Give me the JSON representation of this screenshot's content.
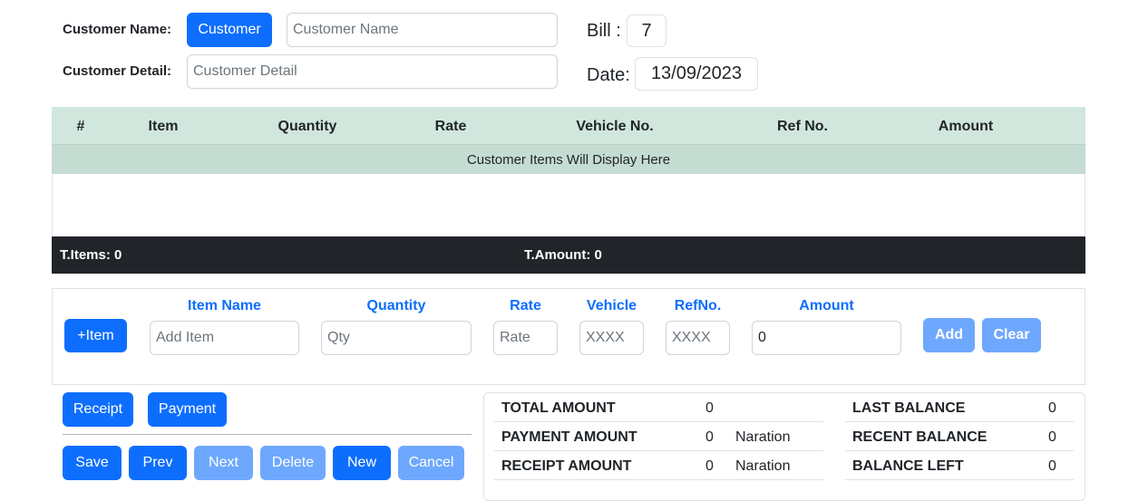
{
  "customer": {
    "name_label": "Customer Name:",
    "customer_button": "Customer",
    "name_placeholder": "Customer Name",
    "detail_label": "Customer Detail:",
    "detail_placeholder": "Customer Detail"
  },
  "bill": {
    "label": "Bill :",
    "number": "7"
  },
  "date": {
    "label": "Date:",
    "value": "13/09/2023"
  },
  "table": {
    "columns": [
      "#",
      "Item",
      "Quantity",
      "Rate",
      "Vehicle No.",
      "Ref No.",
      "Amount"
    ],
    "empty_message": "Customer Items Will Display Here",
    "total_items": "T.Items: 0",
    "total_amount": "T.Amount: 0"
  },
  "item_form": {
    "add_item_button": "+Item",
    "headers": {
      "item_name": "Item Name",
      "quantity": "Quantity",
      "rate": "Rate",
      "vehicle": "Vehicle",
      "refno": "RefNo.",
      "amount": "Amount"
    },
    "placeholders": {
      "item": "Add Item",
      "qty": "Qty",
      "rate": "Rate",
      "vehicle": "XXXX",
      "refno": "XXXX"
    },
    "amount_value": "0",
    "add_button": "Add",
    "clear_button": "Clear"
  },
  "actions": {
    "receipt": "Receipt",
    "payment": "Payment",
    "save": "Save",
    "prev": "Prev",
    "next": "Next",
    "delete": "Delete",
    "new": "New",
    "cancel": "Cancel"
  },
  "summary": {
    "total_amount_label": "TOTAL AMOUNT",
    "total_amount_value": "0",
    "payment_amount_label": "PAYMENT AMOUNT",
    "payment_amount_value": "0",
    "payment_naration": "Naration",
    "receipt_amount_label": "RECEIPT AMOUNT",
    "receipt_amount_value": "0",
    "receipt_naration": "Naration",
    "last_balance_label": "LAST BALANCE",
    "last_balance_value": "0",
    "recent_balance_label": "RECENT BALANCE",
    "recent_balance_value": "0",
    "balance_left_label": "BALANCE LEFT",
    "balance_left_value": "0"
  }
}
